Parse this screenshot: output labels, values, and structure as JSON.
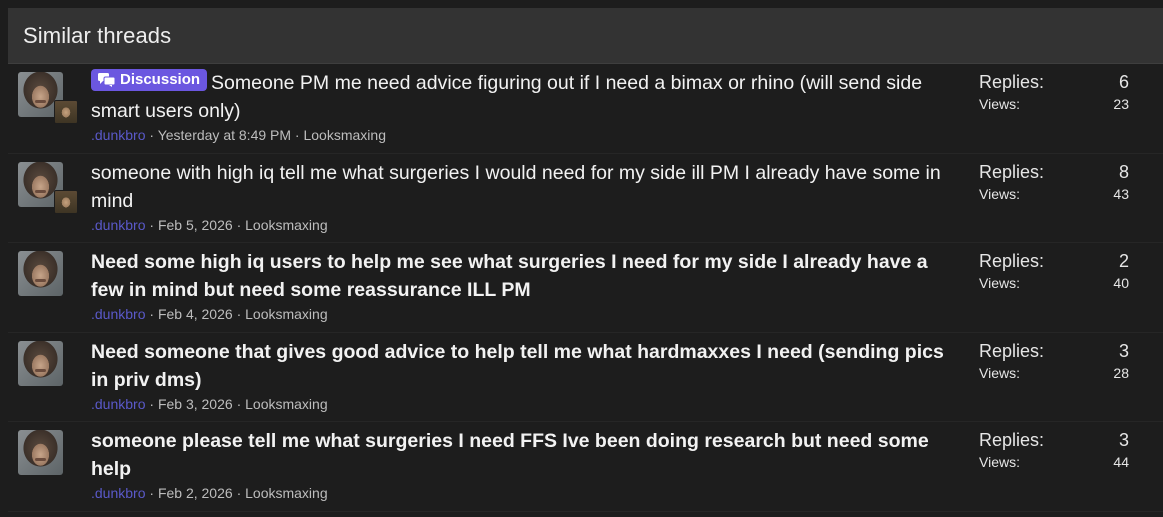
{
  "block": {
    "title": "Similar threads"
  },
  "labels": {
    "replies": "Replies:",
    "views": "Views:",
    "sep": "·"
  },
  "colors": {
    "discussion_badge": "#6b57e0",
    "username": "#5a59c9",
    "header_bg": "#333333",
    "page_bg": "#1d1d1d"
  },
  "threads": [
    {
      "prefix": "Discussion",
      "title": "Someone PM me need advice figuring out if I need a bimax or rhino (will send side smart users only)",
      "user": ".dunkbro",
      "date": "Yesterday at 8:49 PM",
      "forum": "Looksmaxing",
      "replies": "6",
      "views": "23"
    },
    {
      "title": "someone with high iq tell me what surgeries I would need for my side ill PM I already have some in mind",
      "user": ".dunkbro",
      "date": "Feb 5, 2026",
      "forum": "Looksmaxing",
      "replies": "8",
      "views": "43"
    },
    {
      "title": "Need some high iq users to help me see what surgeries I need for my side I already have a few in mind but need some reassurance ILL PM",
      "user": ".dunkbro",
      "date": "Feb 4, 2026",
      "forum": "Looksmaxing",
      "replies": "2",
      "views": "40"
    },
    {
      "title": "Need someone that gives good advice to help tell me what hardmaxxes I need (sending pics in priv dms)",
      "user": ".dunkbro",
      "date": "Feb 3, 2026",
      "forum": "Looksmaxing",
      "replies": "3",
      "views": "28"
    },
    {
      "title": "someone please tell me what surgeries I need FFS Ive been doing research but need some help",
      "user": ".dunkbro",
      "date": "Feb 2, 2026",
      "forum": "Looksmaxing",
      "replies": "3",
      "views": "44"
    }
  ]
}
